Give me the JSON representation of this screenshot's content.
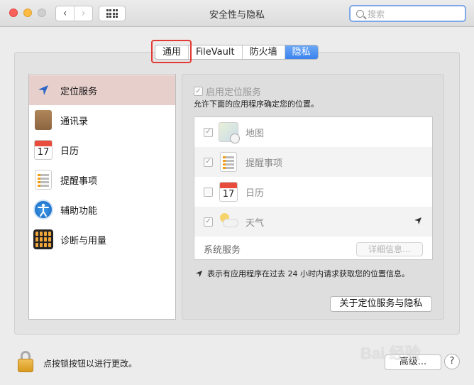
{
  "window": {
    "title": "安全性与隐私",
    "search_placeholder": "搜索"
  },
  "tabs": [
    {
      "label": "通用",
      "active": false
    },
    {
      "label": "FileVault",
      "active": false
    },
    {
      "label": "防火墙",
      "active": false
    },
    {
      "label": "隐私",
      "active": true
    }
  ],
  "sidebar": {
    "items": [
      {
        "label": "定位服务",
        "icon": "location-arrow-icon",
        "selected": true
      },
      {
        "label": "通讯录",
        "icon": "contacts-book-icon",
        "selected": false
      },
      {
        "label": "日历",
        "icon": "calendar-icon",
        "selected": false
      },
      {
        "label": "提醒事项",
        "icon": "reminders-icon",
        "selected": false
      },
      {
        "label": "辅助功能",
        "icon": "accessibility-icon",
        "selected": false
      },
      {
        "label": "诊断与用量",
        "icon": "diagnostics-icon",
        "selected": false
      }
    ]
  },
  "location": {
    "enable_label": "启用定位服务",
    "enable_checked": true,
    "description": "允许下面的应用程序确定您的位置。",
    "apps": [
      {
        "name": "地图",
        "checked": true,
        "icon": "maps-icon",
        "recent": false
      },
      {
        "name": "提醒事项",
        "checked": true,
        "icon": "reminders-icon",
        "recent": false
      },
      {
        "name": "日历",
        "checked": false,
        "icon": "calendar-icon",
        "recent": false
      },
      {
        "name": "天气",
        "checked": true,
        "icon": "weather-icon",
        "recent": true
      }
    ],
    "system_services_label": "系统服务",
    "details_button": "详细信息…",
    "note": "表示有应用程序在过去 24 小时内请求获取您的位置信息。",
    "about_button": "关于定位服务与隐私"
  },
  "calendar_icon": {
    "month": "JUL",
    "day": "17"
  },
  "footer": {
    "lock_text": "点按锁按钮以进行更改。",
    "advanced_button": "高级...",
    "help_button": "?"
  },
  "watermark": {
    "text": "Bai 经验"
  },
  "colors": {
    "active_tab": "#3a82ee",
    "selected_sidebar": "#e7cfcb",
    "highlight_box": "#e33a35"
  }
}
